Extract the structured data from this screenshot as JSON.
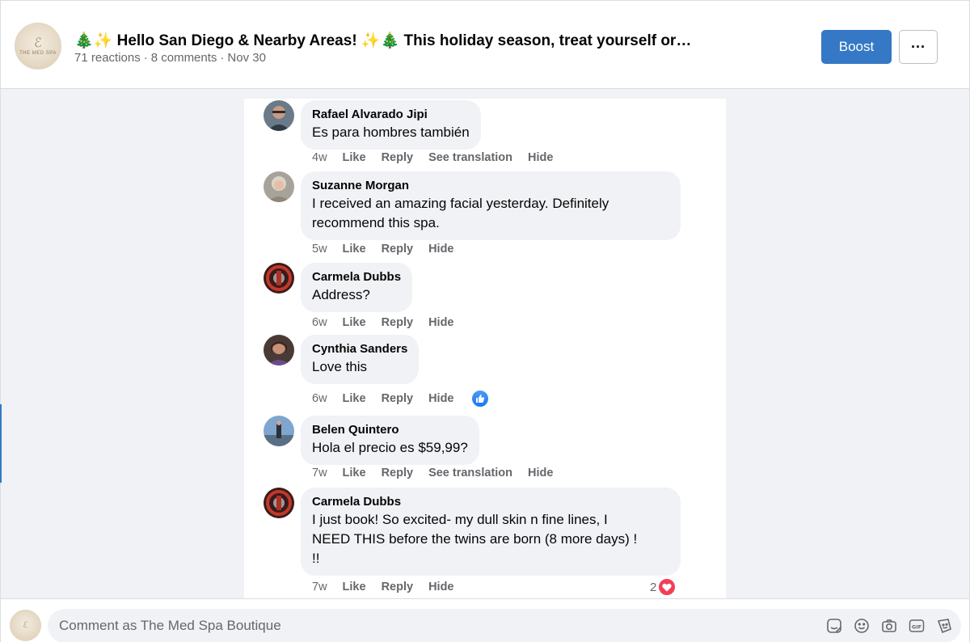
{
  "post": {
    "title": "🎄✨ Hello San Diego & Nearby Areas! ✨🎄 This holiday season, treat yourself or…",
    "reactions": "71 reactions",
    "comments_count": "8 comments",
    "date": "Nov 30",
    "separator": "·"
  },
  "page_avatar": {
    "monogram": "ℰ",
    "brand": "THE MED SPA"
  },
  "toolbar": {
    "boost_label": "Boost",
    "more_label": "···"
  },
  "comments": [
    {
      "author": "Rafael Alvarado Jipi",
      "lines": [
        "Es para hombres también"
      ],
      "time": "4w",
      "like": "Like",
      "reply": "Reply",
      "translate": "See translation",
      "hide": "Hide"
    },
    {
      "author": "Suzanne Morgan",
      "lines": [
        "I received an amazing facial yesterday. Definitely",
        "recommend this spa."
      ],
      "time": "5w",
      "like": "Like",
      "reply": "Reply",
      "hide": "Hide"
    },
    {
      "author": "Carmela Dubbs",
      "lines": [
        "Address?"
      ],
      "time": "6w",
      "like": "Like",
      "reply": "Reply",
      "hide": "Hide"
    },
    {
      "author": "Cynthia Sanders",
      "lines": [
        "Love this"
      ],
      "time": "6w",
      "like": "Like",
      "reply": "Reply",
      "hide": "Hide",
      "reaction": "like"
    },
    {
      "author": "Belen Quintero",
      "lines": [
        "Hola el precio es $59,99?"
      ],
      "time": "7w",
      "like": "Like",
      "reply": "Reply",
      "translate": "See translation",
      "hide": "Hide"
    },
    {
      "author": "Carmela Dubbs",
      "lines": [
        "I just book! So excited- my dull skin n fine lines, I",
        "NEED THIS before the twins are born (8 more days) !",
        "!!"
      ],
      "time": "7w",
      "like": "Like",
      "reply": "Reply",
      "hide": "Hide",
      "reaction": "love",
      "reaction_count": "2"
    }
  ],
  "composer": {
    "placeholder": "Comment as The Med Spa Boutique",
    "icons": [
      "sticker-icon",
      "emoji-icon",
      "camera-icon",
      "gif-icon",
      "avatar-sticker-icon"
    ]
  },
  "colors": {
    "accent": "#3578c6",
    "like_blue": "#1877f2",
    "love_red": "#f33e58",
    "bubble": "#f0f2f5"
  }
}
